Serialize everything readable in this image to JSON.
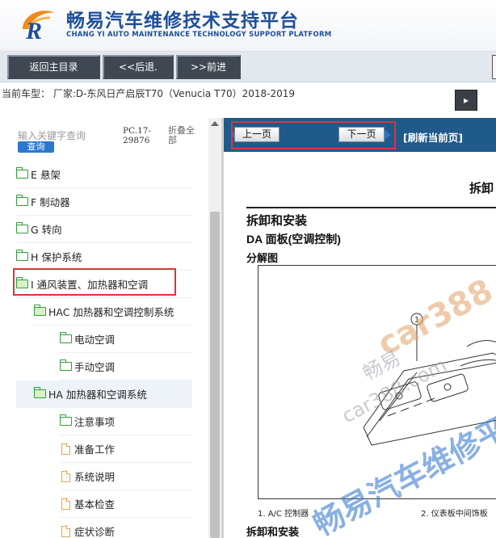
{
  "header": {
    "title": "畅易汽车维修技术支持平台",
    "subtitle": "CHANG YI AUTO MAINTENANCE TECHNOLOGY SUPPORT PLATFORM",
    "brand_color": "#1e4f9c"
  },
  "toolbar": {
    "home_label": "返回主目录",
    "back_label": "<<后退.",
    "forward_label": ">>前进"
  },
  "vehicle": {
    "info": "当前车型： 厂家:D-东风日产启辰T70（Venucia T70）2018-2019",
    "toggle_icon": "▸"
  },
  "sidebar": {
    "search_placeholder": "输入关键字查询",
    "search_button": "查询",
    "pc_code": "PC.17-29876",
    "collapse_all": "折叠全部",
    "items": [
      {
        "label": "E 悬架",
        "type": "folder",
        "level": 0
      },
      {
        "label": "F 制动器",
        "type": "folder",
        "level": 0
      },
      {
        "label": "G 转向",
        "type": "folder",
        "level": 0
      },
      {
        "label": "H 保护系统",
        "type": "folder",
        "level": 0
      },
      {
        "label": "I 通风装置、加热器和空调",
        "type": "folder-open",
        "level": 0
      },
      {
        "label": "HAC 加热器和空调控制系统",
        "type": "folder-open",
        "level": 1
      },
      {
        "label": "电动空调",
        "type": "folder",
        "level": 2
      },
      {
        "label": "手动空调",
        "type": "folder",
        "level": 2
      },
      {
        "label": "HA 加热器和空调系统",
        "type": "folder-open",
        "level": 1
      },
      {
        "label": "注意事项",
        "type": "folder",
        "level": 2
      },
      {
        "label": "准备工作",
        "type": "page",
        "level": 2
      },
      {
        "label": "系统说明",
        "type": "page",
        "level": 2
      },
      {
        "label": "基本检查",
        "type": "page",
        "level": 2
      },
      {
        "label": "症状诊断",
        "type": "page",
        "level": 2
      }
    ]
  },
  "content": {
    "prev_label": "上一页",
    "next_label": "下一页",
    "refresh_label": "[刷新当前页]",
    "partial_heading": "拆卸",
    "heading1": "拆卸和安装",
    "heading2": "DA 面板(空调控制)",
    "heading3": "分解图",
    "diagram_callout": "1",
    "caption1": "1.    A/C 控制器",
    "caption2": "2.    仪表板中间饰板",
    "bottom_heading": "拆卸和安装",
    "watermark_lines": [
      "car388",
      "畅易",
      "car388.com",
      "畅易汽车维修平台"
    ]
  },
  "colors": {
    "nav_strip": "#205a8a",
    "highlight": "#d9363e",
    "folder": "#2f9e3c",
    "page_icon": "#e1a45a",
    "search_button": "#2b78cf"
  }
}
